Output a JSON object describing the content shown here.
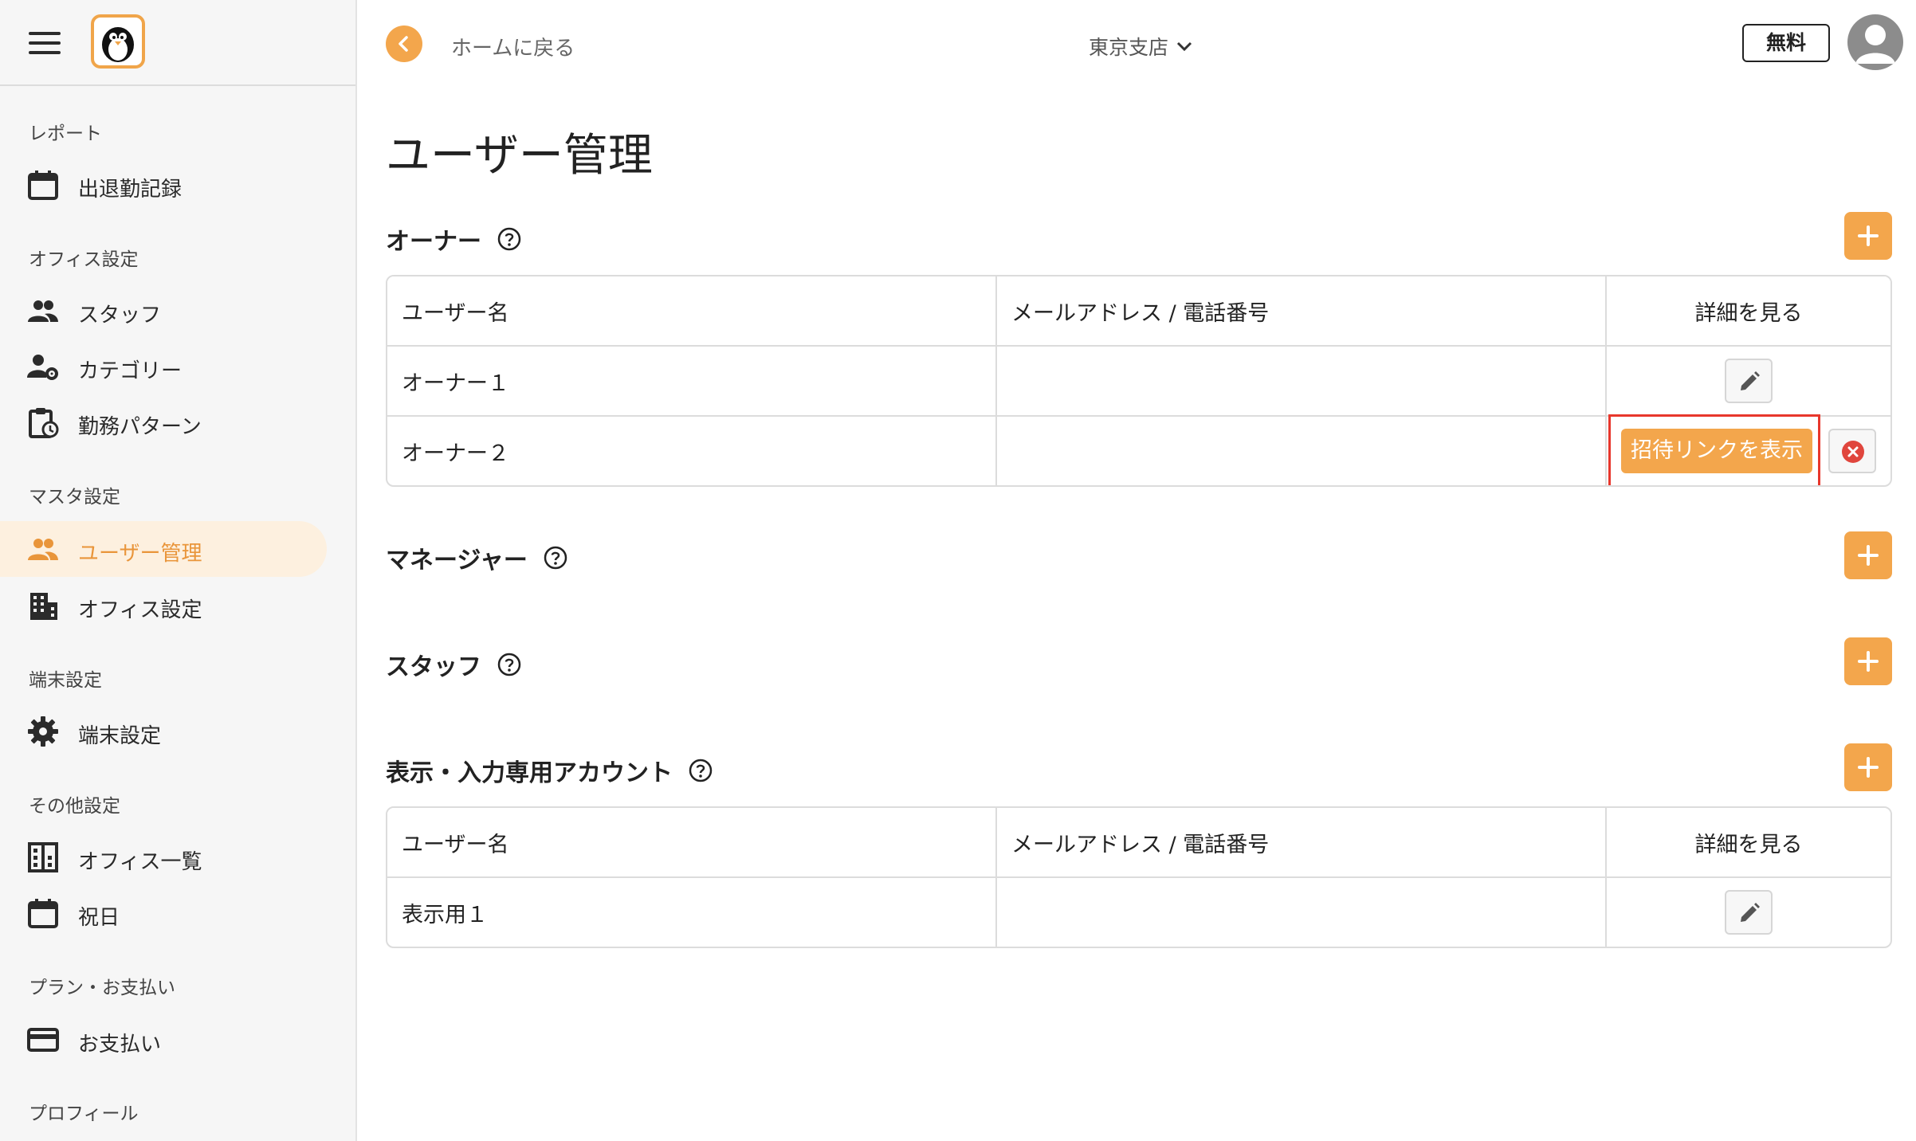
{
  "sidebar": {
    "sections": [
      {
        "label": "レポート",
        "items": [
          {
            "label": "出退勤記録",
            "icon": "calendar-icon"
          }
        ]
      },
      {
        "label": "オフィス設定",
        "items": [
          {
            "label": "スタッフ",
            "icon": "people-icon"
          },
          {
            "label": "カテゴリー",
            "icon": "person-gear-icon"
          },
          {
            "label": "勤務パターン",
            "icon": "clipboard-clock-icon"
          }
        ]
      },
      {
        "label": "マスタ設定",
        "items": [
          {
            "label": "ユーザー管理",
            "icon": "people-icon",
            "active": true
          },
          {
            "label": "オフィス設定",
            "icon": "building-icon"
          }
        ]
      },
      {
        "label": "端末設定",
        "items": [
          {
            "label": "端末設定",
            "icon": "gear-icon"
          }
        ]
      },
      {
        "label": "その他設定",
        "items": [
          {
            "label": "オフィス一覧",
            "icon": "building-grid-icon"
          },
          {
            "label": "祝日",
            "icon": "calendar-icon"
          }
        ]
      },
      {
        "label": "プラン・お支払い",
        "items": [
          {
            "label": "お支払い",
            "icon": "credit-card-icon"
          }
        ]
      },
      {
        "label": "プロフィール",
        "items": []
      }
    ]
  },
  "topbar": {
    "back_label": "ホームに戻る",
    "branch": "東京支店",
    "plan_label": "無料"
  },
  "page": {
    "title": "ユーザー管理"
  },
  "sections": {
    "owner": {
      "title": "オーナー",
      "columns": [
        "ユーザー名",
        "メールアドレス / 電話番号",
        "詳細を見る"
      ],
      "rows": [
        {
          "name": "オーナー１",
          "contact": ""
        },
        {
          "name": "オーナー２",
          "contact": "",
          "invite_label": "招待リンクを表示"
        }
      ]
    },
    "manager": {
      "title": "マネージャー"
    },
    "staff": {
      "title": "スタッフ"
    },
    "viewer": {
      "title": "表示・入力専用アカウント",
      "columns": [
        "ユーザー名",
        "メールアドレス / 電話番号",
        "詳細を見る"
      ],
      "rows": [
        {
          "name": "表示用１",
          "contact": ""
        }
      ]
    }
  },
  "colors": {
    "accent": "#f3a64c",
    "highlight": "#e8372c",
    "delete": "#e0463d"
  }
}
